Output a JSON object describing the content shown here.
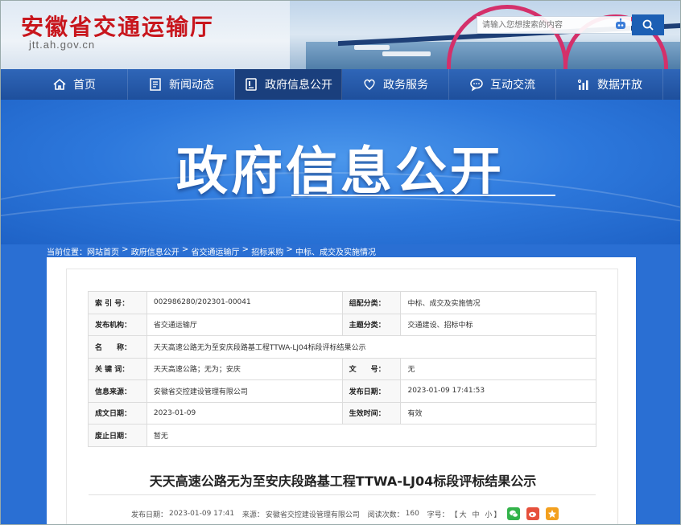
{
  "site": {
    "title": "安徽省交通运输厅",
    "domain": "jtt.ah.gov.cn"
  },
  "search": {
    "placeholder": "请输入您想搜索的内容"
  },
  "nav": {
    "items": [
      {
        "label": "首页",
        "icon": "home-icon"
      },
      {
        "label": "新闻动态",
        "icon": "news-icon"
      },
      {
        "label": "政府信息公开",
        "icon": "document-icon",
        "active": true
      },
      {
        "label": "政务服务",
        "icon": "heart-icon"
      },
      {
        "label": "互动交流",
        "icon": "chat-icon"
      },
      {
        "label": "数据开放",
        "icon": "chart-icon"
      }
    ]
  },
  "banner": {
    "title": "政府信息公开"
  },
  "breadcrumb": {
    "prefix": "当前位置：",
    "items": [
      "网站首页",
      "政府信息公开",
      "省交通运输厅",
      "招标采购",
      "中标、成交及实施情况"
    ],
    "separator": " > "
  },
  "meta": {
    "index_label": "索 引 号：",
    "index_value": "002986280/202301-00041",
    "category_label": "组配分类：",
    "category_value": "中标、成交及实施情况",
    "publisher_label": "发布机构：",
    "publisher_value": "省交通运输厅",
    "topic_label": "主题分类：",
    "topic_value": "交通建设、招标中标",
    "name_label": "名　　称：",
    "name_value": "天天高速公路无为至安庆段路基工程TTWA-LJ04标段评标结果公示",
    "keywords_label": "关 键 词：",
    "keywords_value": "天天高速公路；无为；安庆",
    "docno_label": "文　　号：",
    "docno_value": "无",
    "source_label": "信息来源：",
    "source_value": "安徽省交控建设管理有限公司",
    "pubdate_label": "发布日期：",
    "pubdate_value": "2023-01-09 17:41:53",
    "created_label": "成文日期：",
    "created_value": "2023-01-09",
    "effective_label": "生效时间：",
    "effective_value": "有效",
    "expiry_label": "废止日期：",
    "expiry_value": "暂无"
  },
  "article": {
    "title": "天天高速公路无为至安庆段路基工程TTWA-LJ04标段评标结果公示",
    "date_label": "发布日期：",
    "date_value": "2023-01-09 17:41",
    "source_label": "来源：",
    "source_value": "安徽省交控建设管理有限公司",
    "views_label": "阅读次数：",
    "views_value": "160",
    "fontsize_label": "字号：",
    "fontsize_open": "【",
    "size_large": "大",
    "size_medium": "中",
    "size_small": "小",
    "fontsize_close": "】"
  },
  "colors": {
    "brand_red": "#c8161d",
    "nav_blue": "#1e4f9c",
    "banner_blue": "#2d78dc"
  }
}
